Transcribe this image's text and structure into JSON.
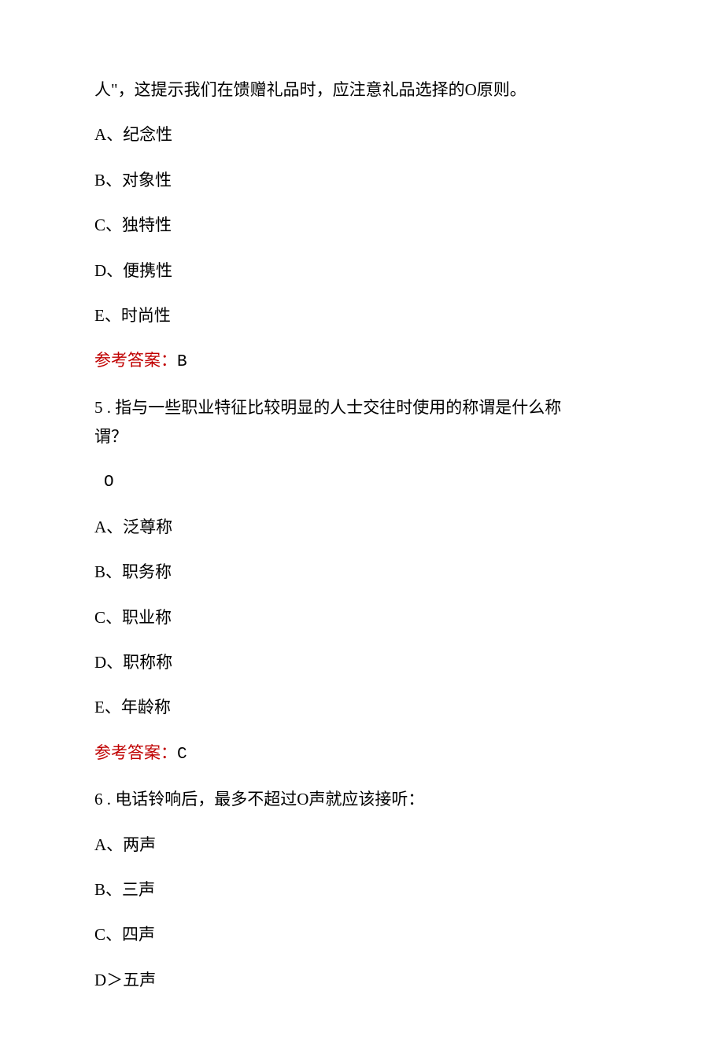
{
  "q4_fragment": "人\"，这提示我们在馈赠礼品时，应注意礼品选择的O原则。",
  "q4": {
    "optA": "A、纪念性",
    "optB": "B、对象性",
    "optC": "C、独特性",
    "optD": "D、便携性",
    "optE": "E、时尚性",
    "answer_label": "参考答案：",
    "answer_value": "B"
  },
  "q5": {
    "text_line1": "5 . 指与一些职业特征比较明显的人士交往时使用的称谓是什么称",
    "text_line2": "谓？",
    "blank": "O",
    "optA": "A、泛尊称",
    "optB": "B、职务称",
    "optC": "C、职业称",
    "optD": "D、职称称",
    "optE": "E、年龄称",
    "answer_label": "参考答案：",
    "answer_value": "C"
  },
  "q6": {
    "text": "6 . 电话铃响后，最多不超过O声就应该接听：",
    "optA": "A、两声",
    "optB": "B、三声",
    "optC": "C、四声",
    "optD": "D＞五声"
  }
}
